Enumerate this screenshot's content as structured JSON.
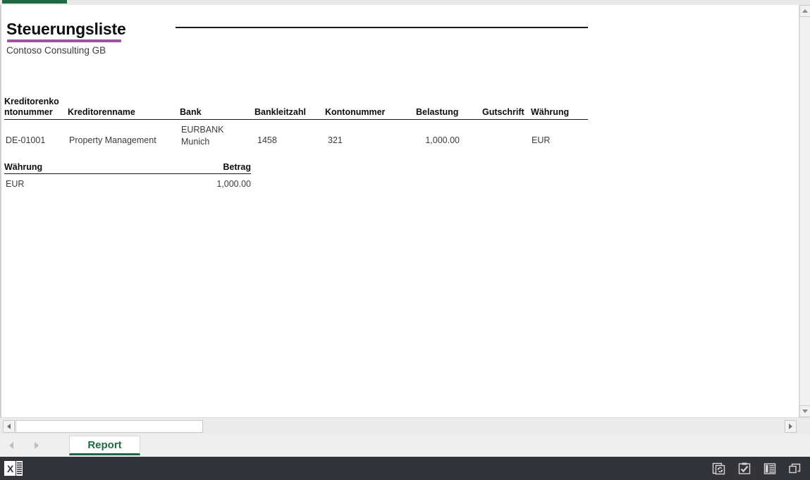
{
  "window": {
    "accent_color": "#1e6b43",
    "title_rule_color": "#a0539f"
  },
  "report": {
    "title": "Steuerungsliste",
    "subtitle": "Contoso Consulting GB",
    "detail_table": {
      "columns": [
        "Kreditorenkontonummer",
        "Kreditorenname",
        "Bank",
        "Bankleitzahl",
        "Kontonummer",
        "Belastung",
        "Gutschrift",
        "Währung"
      ],
      "column_header_line1": "Kreditorenko",
      "column_header_line2": "ntonummer",
      "rows": [
        {
          "kreditorenkontonummer": "DE-01001",
          "kreditorenname": "Property Management",
          "bank": "EURBANK\nMunich",
          "bankleitzahl": "1458",
          "kontonummer": "321",
          "belastung": "1,000.00",
          "gutschrift": "",
          "waehrung": "EUR"
        }
      ]
    },
    "summary_table": {
      "columns": [
        "Währung",
        "Betrag"
      ],
      "rows": [
        {
          "waehrung": "EUR",
          "betrag": "1,000.00"
        }
      ]
    }
  },
  "scrollbars": {
    "vertical_up": "scroll-up",
    "vertical_down": "scroll-down",
    "horizontal_left": "scroll-left",
    "horizontal_right": "scroll-right"
  },
  "sheet_tabs": {
    "previous_label": "previous-sheet",
    "next_label": "next-sheet",
    "tabs": [
      {
        "label": "Report",
        "active": true
      }
    ]
  },
  "status_bar": {
    "app_icon": "excel-icon",
    "icons": [
      {
        "name": "refresh-icon"
      },
      {
        "name": "clipboard-check-icon"
      },
      {
        "name": "reading-view-icon"
      },
      {
        "name": "restore-window-icon"
      }
    ]
  }
}
